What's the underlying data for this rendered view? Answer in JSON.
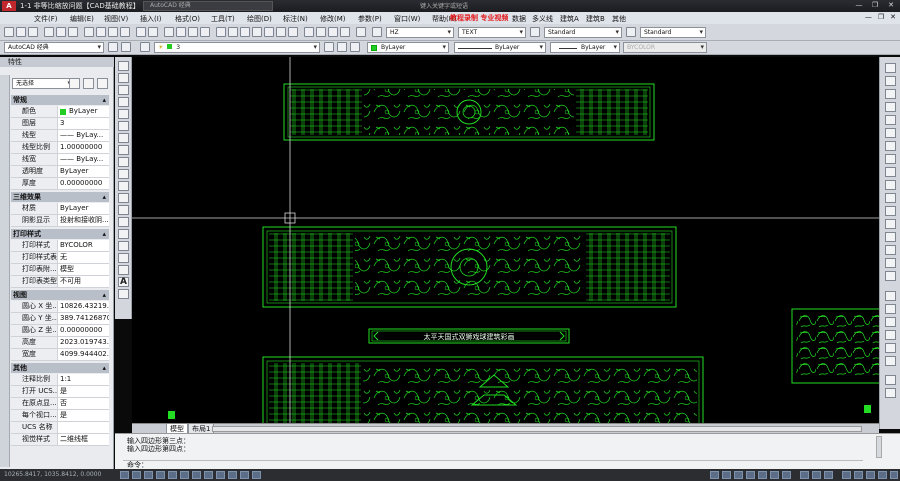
{
  "window": {
    "app_logo": "A",
    "title": "1-1 非等比缩放问题【CAD基础教程】",
    "search_text": "AutoCAD 经典",
    "help_text": "键入关键字或短语",
    "controls": [
      "—",
      "❐",
      "✕"
    ]
  },
  "menu": {
    "items": [
      "文件(F)",
      "编辑(E)",
      "视图(V)",
      "插入(I)",
      "格式(O)",
      "工具(T)",
      "绘图(D)",
      "标注(N)",
      "修改(M)",
      "参数(P)",
      "窗口(W)",
      "帮助(H)",
      "数据",
      "多义线",
      "建筑A",
      "建筑B",
      "其他"
    ],
    "overlay_note": "教程录制 专业视频",
    "window_controls": [
      "—",
      "❐",
      "✕"
    ]
  },
  "toolbar": {
    "workspace": "AutoCAD 经典",
    "text_style": "HZ",
    "text_name": "TEXT",
    "dim_style": "Standard",
    "table_style": "Standard",
    "layer": "3",
    "color": "ByLayer",
    "linetype": "ByLayer",
    "lineweight": "ByLayer",
    "plot_style": "BYCOLOR"
  },
  "properties": {
    "palette_title": "特性",
    "selection": "无选择",
    "sections": [
      {
        "title": "常规",
        "rows": [
          {
            "k": "颜色",
            "v": "ByLayer",
            "swatch": true
          },
          {
            "k": "图层",
            "v": "3"
          },
          {
            "k": "线型",
            "v": "—— ByLay..."
          },
          {
            "k": "线型比例",
            "v": "1.00000000"
          },
          {
            "k": "线宽",
            "v": "—— ByLay..."
          },
          {
            "k": "透明度",
            "v": "ByLayer"
          },
          {
            "k": "厚度",
            "v": "0.00000000"
          }
        ]
      },
      {
        "title": "三维效果",
        "rows": [
          {
            "k": "材质",
            "v": "ByLayer"
          },
          {
            "k": "阴影显示",
            "v": "投射和接收阴..."
          }
        ]
      },
      {
        "title": "打印样式",
        "rows": [
          {
            "k": "打印样式",
            "v": "BYCOLOR"
          },
          {
            "k": "打印样式表",
            "v": "无"
          },
          {
            "k": "打印表附...",
            "v": "模型"
          },
          {
            "k": "打印表类型",
            "v": "不可用"
          }
        ]
      },
      {
        "title": "视图",
        "rows": [
          {
            "k": "圆心 X 坐...",
            "v": "10826.43219..."
          },
          {
            "k": "圆心 Y 坐...",
            "v": "389.74126870"
          },
          {
            "k": "圆心 Z 坐...",
            "v": "0.00000000"
          },
          {
            "k": "高度",
            "v": "2023.019743..."
          },
          {
            "k": "宽度",
            "v": "4099.944402..."
          }
        ]
      },
      {
        "title": "其他",
        "rows": [
          {
            "k": "注释比例",
            "v": "1:1"
          },
          {
            "k": "打开 UCS...",
            "v": "是"
          },
          {
            "k": "在原点显...",
            "v": "否"
          },
          {
            "k": "每个视口...",
            "v": "是"
          },
          {
            "k": "UCS 名称",
            "v": ""
          },
          {
            "k": "视觉样式",
            "v": "二维线框"
          }
        ]
      }
    ]
  },
  "drawing": {
    "caption": "太平天国式双狮戏球建筑彩画"
  },
  "layout_tabs": [
    "模型",
    "布局1"
  ],
  "command": {
    "history": [
      "输入四边形第三点：",
      "输入四边形第四点：",
      ""
    ],
    "prompt": "命令："
  },
  "status": {
    "coords": "10265.8417, 1035.8412, 0.0000"
  },
  "colors": {
    "drawing_line": "#22dd22",
    "canvas_bg": "#000000",
    "accent": "#c0282d"
  }
}
